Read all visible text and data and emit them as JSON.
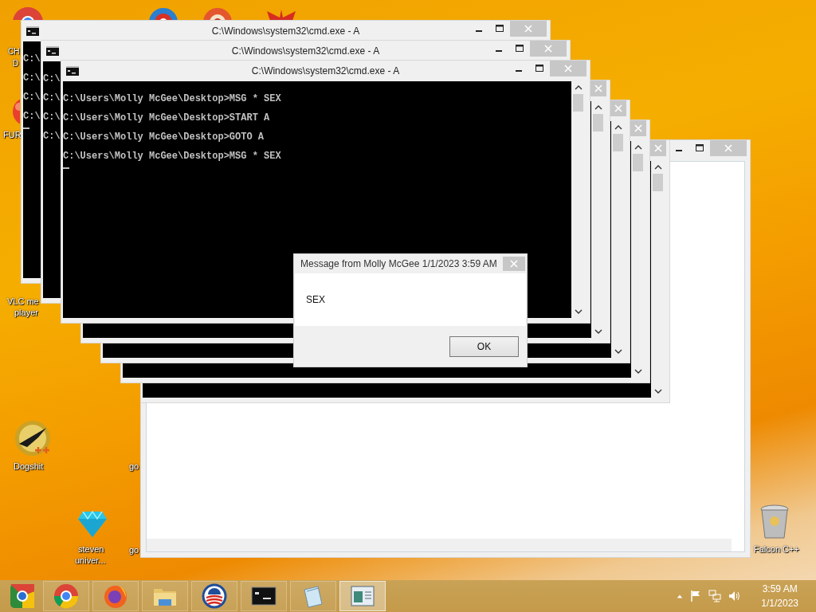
{
  "desktop_icons": [
    {
      "kind": "chrome",
      "label_lines": [
        "CH",
        "D"
      ]
    },
    {
      "kind": "blue-ring"
    },
    {
      "kind": "orange-ring"
    },
    {
      "kind": "red-wings"
    },
    {
      "kind": "red-ball",
      "label_lines": [
        "FUR"
      ]
    },
    {
      "kind": "none",
      "label_lines": [
        "VLC me",
        "player"
      ]
    },
    {
      "kind": "gold-disc",
      "label_lines": [
        "Dogshit"
      ]
    },
    {
      "kind": "none",
      "label_lines": [
        "go"
      ]
    },
    {
      "kind": "diamond",
      "label_lines": [
        "steven",
        "univer..."
      ]
    },
    {
      "kind": "none",
      "label_lines": [
        "go"
      ]
    },
    {
      "kind": "bin",
      "label_lines": [
        "Falcon C++"
      ]
    }
  ],
  "background_window": {
    "kind": "blank"
  },
  "cmd_windows": [
    {
      "kind": "console",
      "title": "C:\\Windows\\system32\\cmd.exe - A",
      "lines": [
        "C:\\",
        "C:\\",
        "C:\\",
        "C:\\"
      ],
      "cursor": true
    },
    {
      "kind": "console",
      "title": "C:\\Windows\\system32\\cmd.exe - A",
      "lines": [
        "C:\\",
        "C:\\",
        "C:\\",
        "C:\\"
      ],
      "cursor": false
    },
    {
      "kind": "console",
      "title": "C:\\Windows\\system32\\cmd.exe - A",
      "lines": [
        "C:\\Users\\Molly McGee\\Desktop>MSG * SEX",
        "C:\\Users\\Molly McGee\\Desktop>START A",
        "C:\\Users\\Molly McGee\\Desktop>GOTO A",
        "C:\\Users\\Molly McGee\\Desktop>MSG * SEX"
      ],
      "cursor": true
    },
    {
      "kind": "console"
    },
    {
      "kind": "console"
    },
    {
      "kind": "console"
    },
    {
      "kind": "console"
    }
  ],
  "message_box": {
    "title": "Message from Molly McGee 1/1/2023 3:59 AM",
    "text": "SEX",
    "button": "OK"
  },
  "taskbar": {
    "items": [
      {
        "kind": "chromium",
        "selected": false
      },
      {
        "kind": "chrome",
        "selected": false
      },
      {
        "kind": "firefox",
        "selected": false
      },
      {
        "kind": "folder",
        "selected": false
      },
      {
        "kind": "emblem",
        "selected": false
      },
      {
        "kind": "console",
        "selected": false
      },
      {
        "kind": "notepad",
        "selected": false
      },
      {
        "kind": "window",
        "selected": true
      }
    ],
    "time": "3:59 AM",
    "date": "1/1/2023"
  }
}
